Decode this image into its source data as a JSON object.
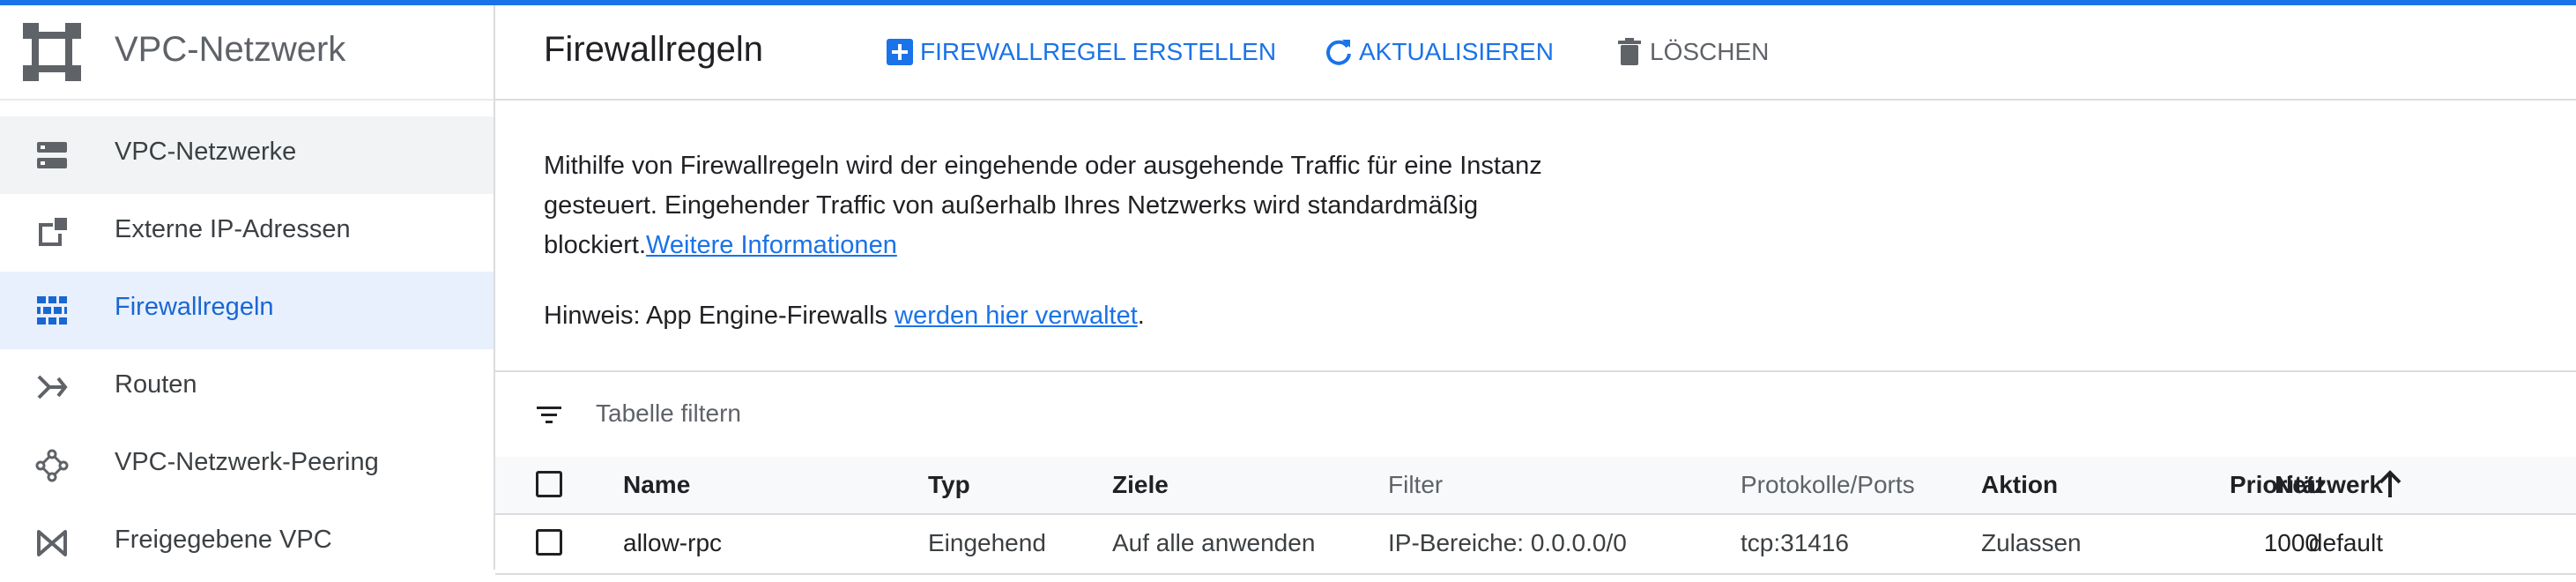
{
  "colors": {
    "accent": "#1a73e8",
    "active_bg": "#e8f0fe",
    "text": "#202124",
    "muted": "#5f6368"
  },
  "sidebar": {
    "title": "VPC-Netzwerk",
    "product_icon": "vpc-network-icon",
    "items": [
      {
        "label": "VPC-Netzwerke",
        "icon": "vpc-networks-icon",
        "state": "hover"
      },
      {
        "label": "Externe IP-Adressen",
        "icon": "external-ip-icon",
        "state": "normal"
      },
      {
        "label": "Firewallregeln",
        "icon": "firewall-icon",
        "state": "active"
      },
      {
        "label": "Routen",
        "icon": "routes-icon",
        "state": "normal"
      },
      {
        "label": "VPC-Netzwerk-Peering",
        "icon": "peering-icon",
        "state": "normal"
      },
      {
        "label": "Freigegebene VPC",
        "icon": "shared-vpc-icon",
        "state": "normal"
      }
    ]
  },
  "toolbar": {
    "page_title": "Firewallregeln",
    "create_label": "FIREWALLREGEL ERSTELLEN",
    "refresh_label": "AKTUALISIEREN",
    "delete_label": "LÖSCHEN"
  },
  "info": {
    "text": "Mithilfe von Firewallregeln wird der eingehende oder ausgehende Traffic für eine Instanz gesteuert. Eingehender Traffic von außerhalb Ihres Netzwerks wird standardmäßig blockiert.",
    "link": "Weitere Informationen",
    "note_prefix": "Hinweis: App Engine-Firewalls ",
    "note_link": "werden hier verwaltet",
    "note_suffix": "."
  },
  "filter": {
    "placeholder": "Tabelle filtern"
  },
  "table": {
    "columns": {
      "name": "Name",
      "type": "Typ",
      "targets": "Ziele",
      "filter": "Filter",
      "protocols": "Protokolle/Ports",
      "action": "Aktion",
      "priority": "Priorität",
      "network": "Netzwerk"
    },
    "sort": {
      "column": "network",
      "direction": "ascending"
    },
    "rows": [
      {
        "name": "allow-rpc",
        "type": "Eingehend",
        "targets": "Auf alle anwenden",
        "filter": "IP-Bereiche: 0.0.0.0/0",
        "protocols": "tcp:31416",
        "action": "Zulassen",
        "priority": "1000",
        "network": "default"
      }
    ]
  }
}
